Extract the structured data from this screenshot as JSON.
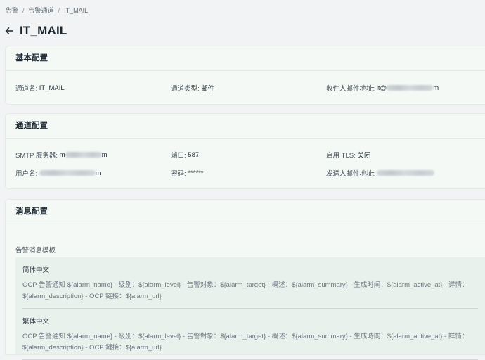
{
  "breadcrumb": {
    "items": [
      "告警",
      "告警通道",
      "IT_MAIL"
    ],
    "separator": "/"
  },
  "page": {
    "title": "IT_MAIL"
  },
  "basic": {
    "header": "基本配置",
    "channel_name_label": "通道名:",
    "channel_name_value": "IT_MAIL",
    "channel_type_label": "通道类型:",
    "channel_type_value": "邮件",
    "recipient_label": "收件人邮件地址:",
    "recipient_prefix": "it@",
    "recipient_suffix": "m"
  },
  "channel": {
    "header": "通道配置",
    "smtp_label": "SMTP 服务器:",
    "smtp_prefix": "m",
    "smtp_suffix": "m",
    "port_label": "端口:",
    "port_value": "587",
    "tls_label": "启用 TLS:",
    "tls_value": "关闭",
    "username_label": "用户名:",
    "username_suffix": "m",
    "password_label": "密码:",
    "password_value": "******",
    "sender_label": "发送人邮件地址:"
  },
  "message": {
    "header": "消息配置",
    "template_label": "告警消息模板",
    "templates": [
      {
        "name": "简体中文",
        "line1": "OCP 告警通知 ${alarm_name} - 级别：${alarm_level} - 告警对象：${alarm_target} - 概述：${alarm_summary} - 生成时间：${alarm_active_at} - 详情：",
        "line2": "${alarm_description} - OCP 链接：${alarm_url}"
      },
      {
        "name": "繁体中文",
        "line1": "OCP 告警通知 ${alarm_name} - 級別：${alarm_level} - 告警對象：${alarm_target} - 概述：${alarm_summary} - 生成時間：${alarm_active_at} - 詳情：",
        "line2": "${alarm_description} - OCP 鏈接：${alarm_url}"
      }
    ]
  },
  "icons": {
    "back": "arrow-left-icon"
  }
}
